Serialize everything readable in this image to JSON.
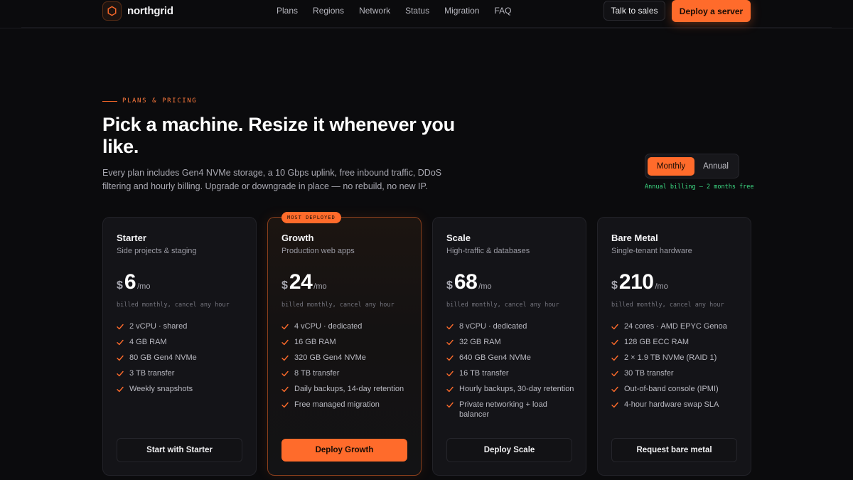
{
  "brand": {
    "name": "northgrid",
    "logo_icon": "hexagon-icon"
  },
  "nav": {
    "links": [
      "Plans",
      "Regions",
      "Network",
      "Status",
      "Migration",
      "FAQ"
    ],
    "talk_to_sales": "Talk to sales",
    "deploy_server": "Deploy a server"
  },
  "hero": {
    "eyebrow": "PLANS & PRICING",
    "title": "Pick a machine. Resize it whenever you like.",
    "description": "Every plan includes Gen4 NVMe storage, a 10 Gbps uplink, free inbound traffic, DDoS filtering and hourly billing. Upgrade or downgrade in place — no rebuild, no new IP."
  },
  "billing_toggle": {
    "monthly": "Monthly",
    "annual": "Annual",
    "selected": "Monthly",
    "note": "Annual billing — 2 months free"
  },
  "colors": {
    "accent": "#ff6b2b",
    "success": "#3ddc84",
    "background": "#0b0b0d"
  },
  "plans": [
    {
      "name": "Starter",
      "subtitle": "Side projects & staging",
      "currency": "$",
      "price": "6",
      "period": "/mo",
      "billed": "billed monthly, cancel any hour",
      "features": [
        "2 vCPU · shared",
        "4 GB RAM",
        "80 GB Gen4 NVMe",
        "3 TB transfer",
        "Weekly snapshots"
      ],
      "cta": "Start with Starter"
    },
    {
      "name": "Growth",
      "subtitle": "Production web apps",
      "badge": "MOST DEPLOYED",
      "currency": "$",
      "price": "24",
      "period": "/mo",
      "billed": "billed monthly, cancel any hour",
      "features": [
        "4 vCPU · dedicated",
        "16 GB RAM",
        "320 GB Gen4 NVMe",
        "8 TB transfer",
        "Daily backups, 14-day retention",
        "Free managed migration"
      ],
      "cta": "Deploy Growth"
    },
    {
      "name": "Scale",
      "subtitle": "High-traffic & databases",
      "currency": "$",
      "price": "68",
      "period": "/mo",
      "billed": "billed monthly, cancel any hour",
      "features": [
        "8 vCPU · dedicated",
        "32 GB RAM",
        "640 GB Gen4 NVMe",
        "16 TB transfer",
        "Hourly backups, 30-day retention",
        "Private networking + load balancer"
      ],
      "cta": "Deploy Scale"
    },
    {
      "name": "Bare Metal",
      "subtitle": "Single-tenant hardware",
      "currency": "$",
      "price": "210",
      "period": "/mo",
      "billed": "billed monthly, cancel any hour",
      "features": [
        "24 cores · AMD EPYC Genoa",
        "128 GB ECC RAM",
        "2 × 1.9 TB NVMe (RAID 1)",
        "30 TB transfer",
        "Out-of-band console (IPMI)",
        "4-hour hardware swap SLA"
      ],
      "cta": "Request bare metal"
    }
  ]
}
